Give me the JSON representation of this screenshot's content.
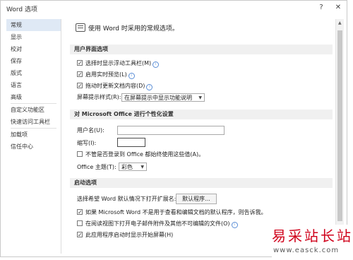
{
  "window": {
    "title": "Word 选项",
    "help": "?",
    "close": "✕"
  },
  "sidebar": {
    "items": [
      "常规",
      "显示",
      "校对",
      "保存",
      "版式",
      "语言",
      "高级",
      "自定义功能区",
      "快速访问工具栏",
      "加载项",
      "信任中心"
    ],
    "active": 0
  },
  "main": {
    "intro": "使用 Word 时采用的常规选项。",
    "ui_section": {
      "header": "用户界面选项",
      "opt1": "选择时显示浮动工具栏(M)",
      "opt2": "启用实时预览(L)",
      "opt3": "拖动时更新文档内容(D)",
      "tip_label": "屏幕提示样式(R):",
      "tip_value": "在屏幕提示中显示功能说明"
    },
    "personal_section": {
      "header": "对 Microsoft Office 进行个性化设置",
      "username_label": "用户名(U):",
      "username_value": "",
      "initials_label": "缩写(I):",
      "initials_value": "",
      "always_use": "不管是否登录到 Office 都始终使用这些值(A)。",
      "theme_label": "Office 主题(T):",
      "theme_value": "彩色"
    },
    "startup_section": {
      "header": "启动选项",
      "ext_label": "选择希望 Word 默认情况下打开扩展名:",
      "default_programs": "默认程序...",
      "opt1": "如果 Microsoft Word 不是用于查看和编辑文档的默认程序，则告诉我。",
      "opt2": "在阅读视图下打开电子邮件附件及其他不可编辑的文件(O)",
      "opt3": "此应用程序启动时显示开始屏幕(H)"
    }
  },
  "watermark": {
    "line1": "易采站长站",
    "line2": "www.easck.com"
  }
}
